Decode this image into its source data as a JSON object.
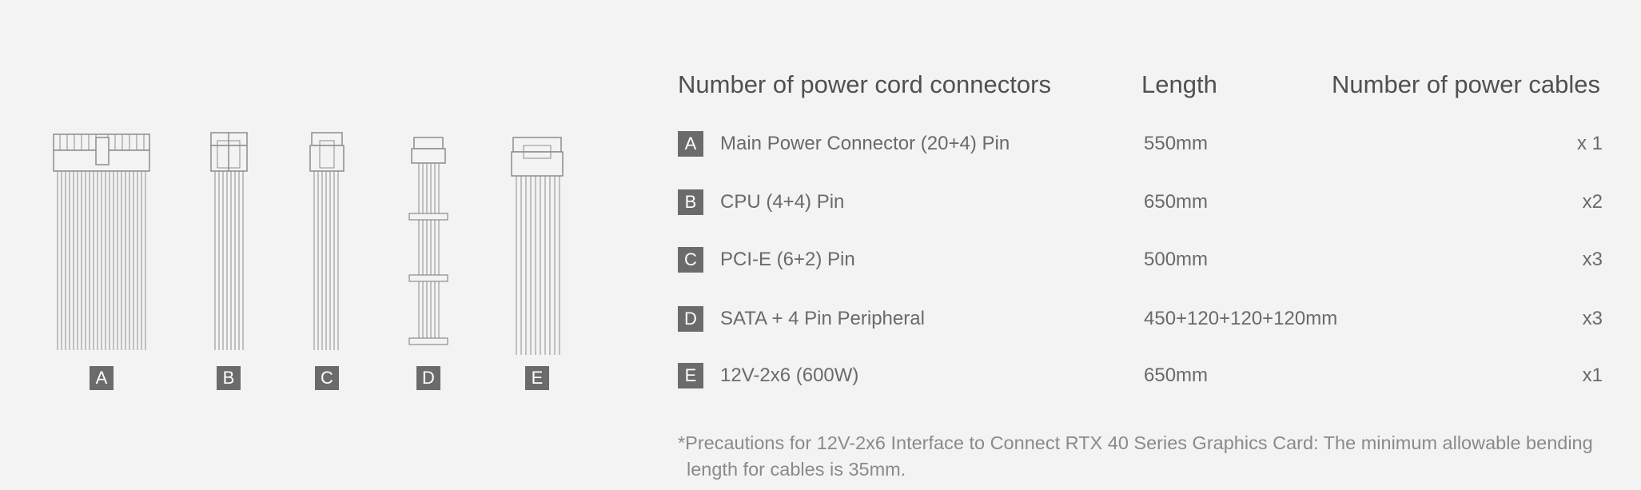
{
  "headers": {
    "connectors": "Number of power cord connectors",
    "length": "Length",
    "cables": "Number of power cables"
  },
  "rows": [
    {
      "letter": "A",
      "name": "Main Power Connector (20+4) Pin",
      "length": "550mm",
      "qty": "x 1"
    },
    {
      "letter": "B",
      "name": "CPU (4+4) Pin",
      "length": "650mm",
      "qty": "x2"
    },
    {
      "letter": "C",
      "name": "PCI-E (6+2) Pin",
      "length": "500mm",
      "qty": "x3"
    },
    {
      "letter": "D",
      "name": "SATA + 4 Pin Peripheral",
      "length": "450+120+120+120mm",
      "qty": "x3"
    },
    {
      "letter": "E",
      "name": "12V-2x6 (600W)",
      "length": "650mm",
      "qty": "x1"
    }
  ],
  "cable_labels": [
    "A",
    "B",
    "C",
    "D",
    "E"
  ],
  "note": "*Precautions for 12V-2x6 Interface to Connect RTX 40 Series Graphics Card: The minimum allowable bending length for cables is 35mm.",
  "colors": {
    "badge": "#6b6b6b",
    "background": "#f3f3f3",
    "line": "#8c8c8c"
  }
}
